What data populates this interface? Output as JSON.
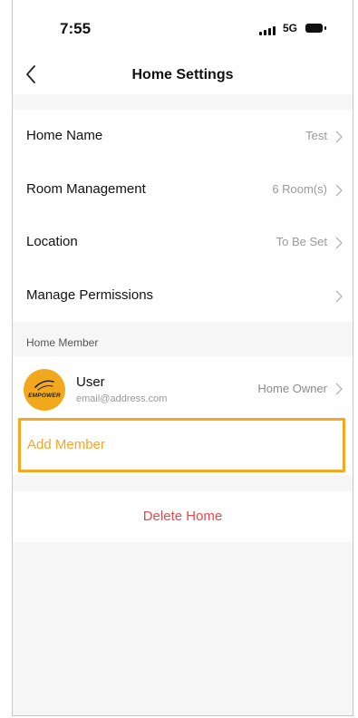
{
  "status_bar": {
    "time": "7:55",
    "network": "5G"
  },
  "nav": {
    "title": "Home Settings"
  },
  "settings": [
    {
      "label": "Home Name",
      "value": "Test"
    },
    {
      "label": "Room Management",
      "value": "6 Room(s)"
    },
    {
      "label": "Location",
      "value": "To Be Set"
    },
    {
      "label": "Manage Permissions",
      "value": ""
    }
  ],
  "members_section": {
    "title": "Home Member"
  },
  "member": {
    "name": "User",
    "email": "email@address.com",
    "role": "Home Owner",
    "avatar_text": "EMPOWER"
  },
  "add_member": {
    "label": "Add Member"
  },
  "delete_home": {
    "label": "Delete Home"
  },
  "colors": {
    "accent": "#f5a623",
    "danger": "#e24a4a",
    "avatar": "#f2a81d"
  }
}
